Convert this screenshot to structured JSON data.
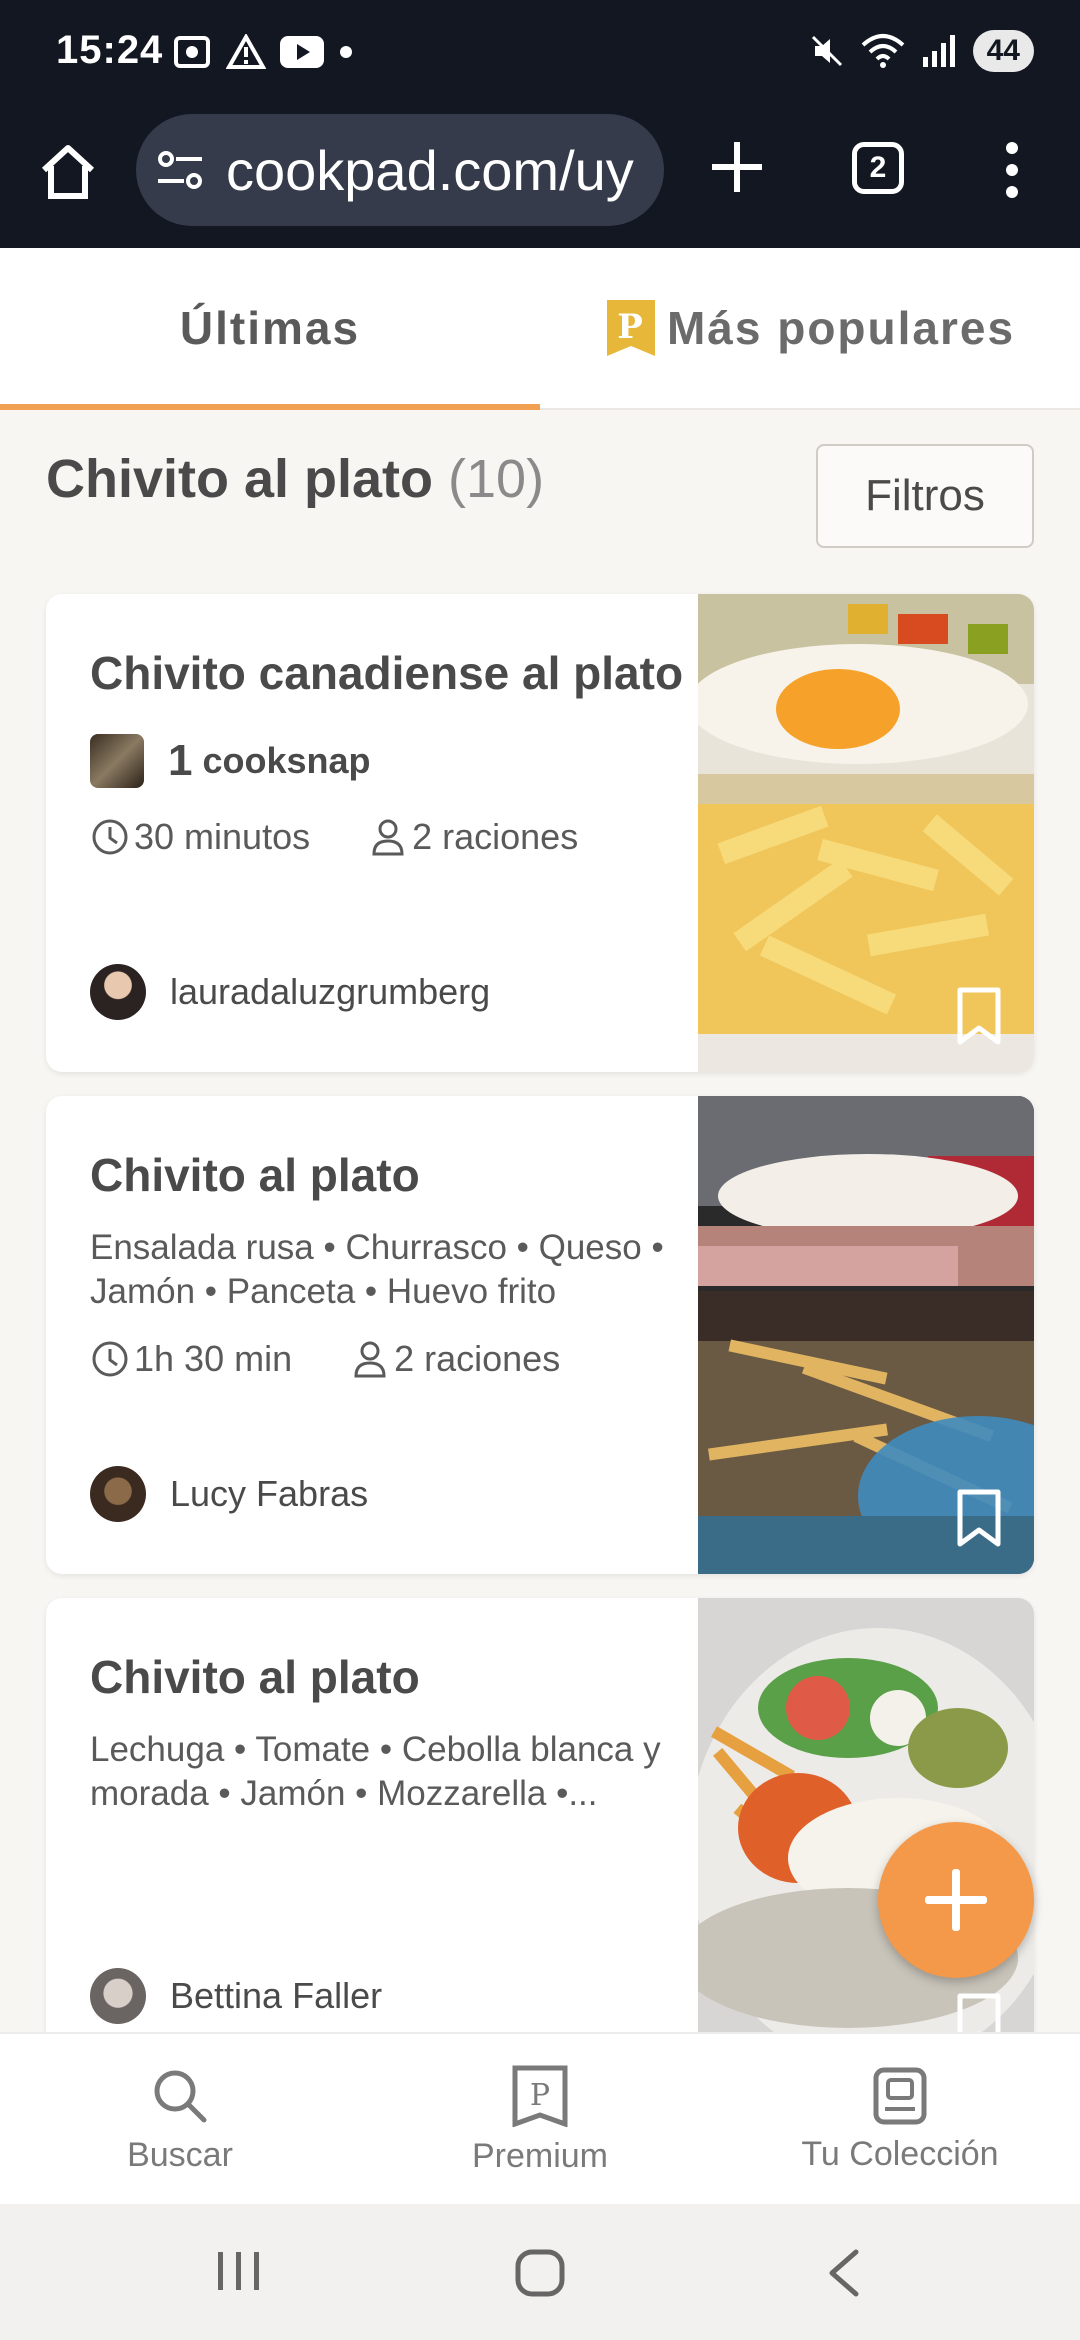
{
  "status_bar": {
    "time": "15:24",
    "battery": "44",
    "icons_left": [
      "screenshot-icon",
      "warning-icon",
      "youtube-icon",
      "dot-icon"
    ],
    "icons_right": [
      "mute-icon",
      "wifi-icon",
      "signal-icon",
      "battery-icon"
    ]
  },
  "browser": {
    "url": "cookpad.com/uy",
    "tab_count": "2"
  },
  "tabs": {
    "latest": "Últimas",
    "popular": "Más populares",
    "active": "latest"
  },
  "results": {
    "query": "Chivito al plato",
    "count": "(10)",
    "filters_label": "Filtros"
  },
  "recipes": [
    {
      "title": "Chivito canadiense al plato",
      "cooksnap_count": "1",
      "cooksnap_label": "cooksnap",
      "time": "30 minutos",
      "servings": "2 raciones",
      "author": "lauradaluzgrumberg"
    },
    {
      "title": "Chivito al plato",
      "ingredients_line1": "Ensalada rusa • Churrasco • Queso •",
      "ingredients_line2": "Jamón • Panceta • Huevo frito",
      "time": "1h 30 min",
      "servings": "2 raciones",
      "author": "Lucy Fabras"
    },
    {
      "title": "Chivito al plato",
      "ingredients_line1": "Lechuga • Tomate • Cebolla blanca y",
      "ingredients_line2": "morada • Jamón • Mozzarella •...",
      "author": "Bettina Faller"
    }
  ],
  "bottom_nav": {
    "search": "Buscar",
    "premium": "Premium",
    "collection": "Tu Colección"
  },
  "colors": {
    "accent": "#f4994a",
    "premium_gold": "#e7b73a",
    "browser_bar": "#121722"
  }
}
